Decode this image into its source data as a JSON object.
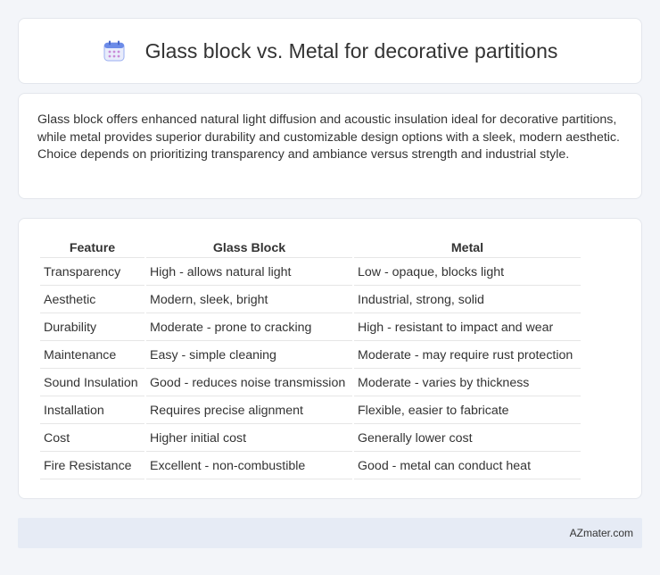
{
  "header": {
    "title": "Glass block vs. Metal for decorative partitions",
    "icon": "calendar-icon"
  },
  "summary": {
    "text": "Glass block offers enhanced natural light diffusion and acoustic insulation ideal for decorative partitions, while metal provides superior durability and customizable design options with a sleek, modern aesthetic. Choice depends on prioritizing transparency and ambiance versus strength and industrial style."
  },
  "table": {
    "headers": [
      "Feature",
      "Glass Block",
      "Metal"
    ],
    "rows": [
      [
        "Transparency",
        "High - allows natural light",
        "Low - opaque, blocks light"
      ],
      [
        "Aesthetic",
        "Modern, sleek, bright",
        "Industrial, strong, solid"
      ],
      [
        "Durability",
        "Moderate - prone to cracking",
        "High - resistant to impact and wear"
      ],
      [
        "Maintenance",
        "Easy - simple cleaning",
        "Moderate - may require rust protection"
      ],
      [
        "Sound Insulation",
        "Good - reduces noise transmission",
        "Moderate - varies by thickness"
      ],
      [
        "Installation",
        "Requires precise alignment",
        "Flexible, easier to fabricate"
      ],
      [
        "Cost",
        "Higher initial cost",
        "Generally lower cost"
      ],
      [
        "Fire Resistance",
        "Excellent - non-combustible",
        "Good - metal can conduct heat"
      ]
    ]
  },
  "footer": {
    "brand": "AZmater.com"
  },
  "colors": {
    "background": "#f3f5f9",
    "footer": "#e6ebf5",
    "icon_accent": "#6b8be8"
  }
}
